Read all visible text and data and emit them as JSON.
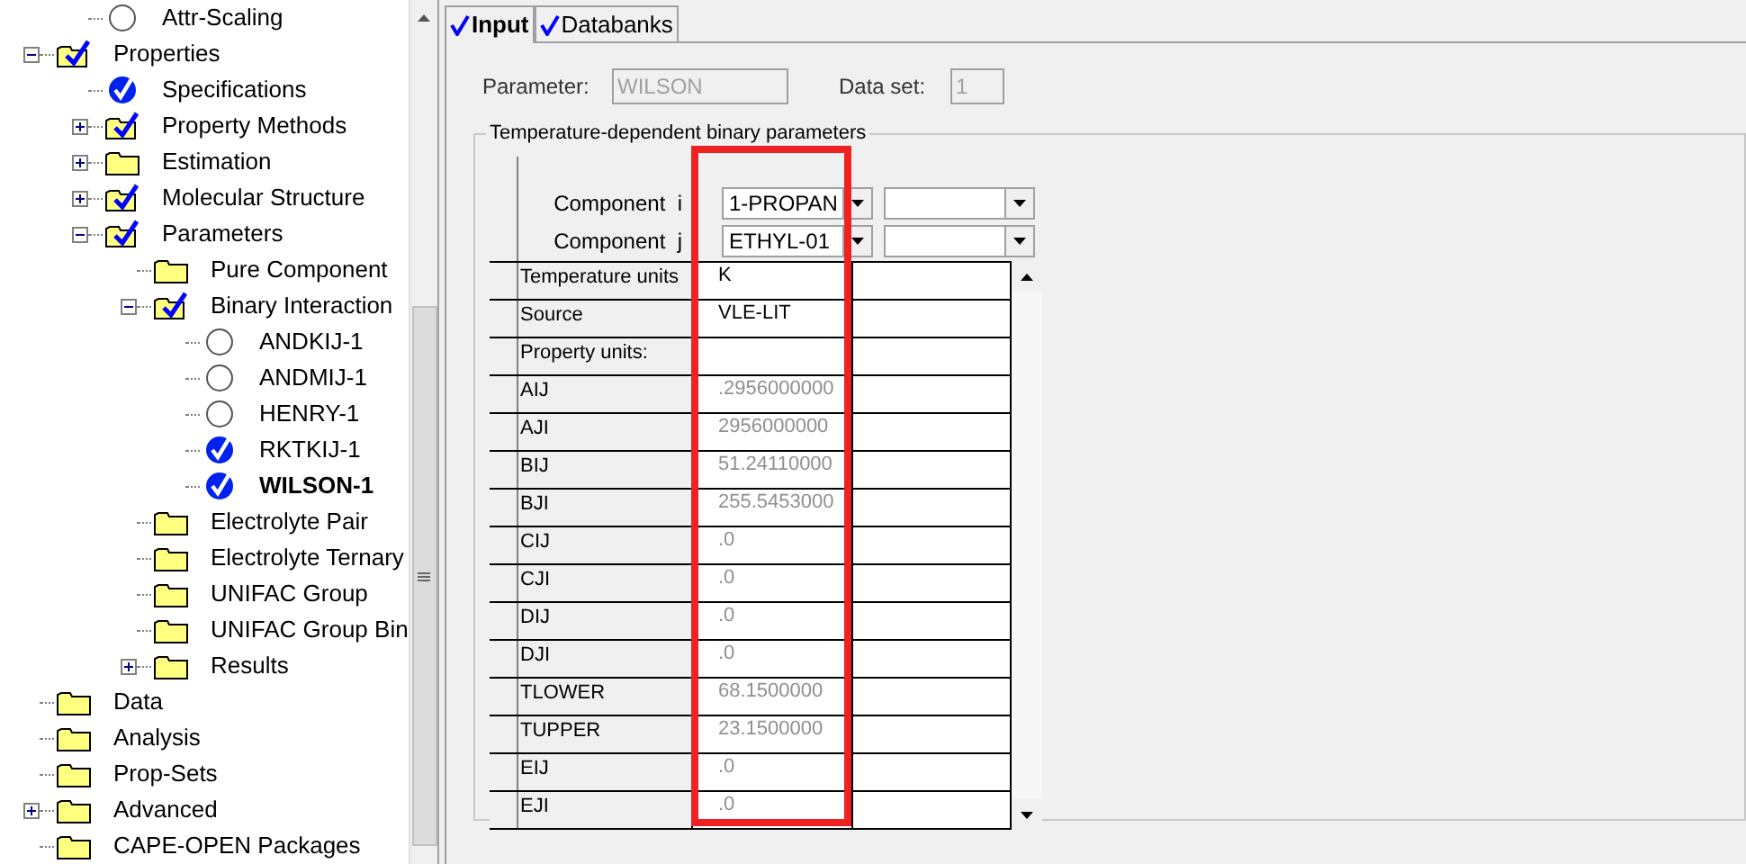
{
  "tree_top_children": [
    {
      "label": "Attr-Scaling",
      "kind": "circle",
      "selected": false
    }
  ],
  "tree": [
    {
      "label": "Properties",
      "kind": "checked-folder",
      "expanded": true,
      "selected": false,
      "children": [
        {
          "label": "Specifications",
          "kind": "check-circle",
          "selected": false
        },
        {
          "label": "Property Methods",
          "kind": "checked-folder",
          "expanded": false,
          "selected": false
        },
        {
          "label": "Estimation",
          "kind": "folder",
          "expanded": false,
          "selected": false
        },
        {
          "label": "Molecular Structure",
          "kind": "checked-folder",
          "expanded": false,
          "selected": false
        },
        {
          "label": "Parameters",
          "kind": "checked-folder",
          "expanded": true,
          "selected": false,
          "children": [
            {
              "label": "Pure Component",
              "kind": "folder",
              "selected": false
            },
            {
              "label": "Binary Interaction",
              "kind": "checked-folder",
              "expanded": true,
              "selected": false,
              "children": [
                {
                  "label": "ANDKIJ-1",
                  "kind": "circle",
                  "selected": false
                },
                {
                  "label": "ANDMIJ-1",
                  "kind": "circle",
                  "selected": false
                },
                {
                  "label": "HENRY-1",
                  "kind": "circle",
                  "selected": false
                },
                {
                  "label": "RKTKIJ-1",
                  "kind": "check-circle",
                  "selected": false
                },
                {
                  "label": "WILSON-1",
                  "kind": "check-circle",
                  "selected": true
                }
              ]
            },
            {
              "label": "Electrolyte Pair",
              "kind": "folder",
              "selected": false
            },
            {
              "label": "Electrolyte Ternary",
              "kind": "folder",
              "selected": false
            },
            {
              "label": "UNIFAC Group",
              "kind": "folder",
              "selected": false
            },
            {
              "label": "UNIFAC Group Bin",
              "kind": "folder",
              "selected": false
            },
            {
              "label": "Results",
              "kind": "folder",
              "expanded": false,
              "selected": false
            }
          ]
        }
      ]
    },
    {
      "label": "Data",
      "kind": "folder",
      "selected": false
    },
    {
      "label": "Analysis",
      "kind": "folder",
      "selected": false
    },
    {
      "label": "Prop-Sets",
      "kind": "folder",
      "selected": false
    },
    {
      "label": "Advanced",
      "kind": "folder",
      "expanded": false,
      "selected": false
    },
    {
      "label": "CAPE-OPEN Packages",
      "kind": "folder",
      "selected": false
    }
  ],
  "tabs": [
    {
      "label": "Input",
      "checked": true,
      "selected": true
    },
    {
      "label": "Databanks",
      "checked": true,
      "selected": false
    }
  ],
  "parameter": {
    "label": "Parameter:",
    "value": "WILSON",
    "disabled": true
  },
  "data_set": {
    "label": "Data set:",
    "value": "1",
    "disabled": true
  },
  "group_title": "Temperature-dependent binary parameters",
  "components": [
    {
      "label": "Component  i",
      "value": "1-PROPAN"
    },
    {
      "label": "Component  j",
      "value": "ETHYL-01"
    }
  ],
  "rows": [
    {
      "label": "Temperature units",
      "value": "K",
      "kind": "setting"
    },
    {
      "label": "Source",
      "value": "VLE-LIT",
      "kind": "setting"
    },
    {
      "label": "Property units:",
      "kind": "setting"
    },
    {
      "label": "AIJ",
      "value": ".2956000000",
      "kind": "parameter"
    },
    {
      "label": "AJI",
      "value": "2956000000",
      "kind": "parameter"
    },
    {
      "label": "BIJ",
      "value": "51.24110000",
      "kind": "parameter"
    },
    {
      "label": "BJI",
      "value": "255.5453000",
      "kind": "parameter"
    },
    {
      "label": "CIJ",
      "value": ".0",
      "kind": "parameter"
    },
    {
      "label": "CJI",
      "value": ".0",
      "kind": "parameter"
    },
    {
      "label": "DIJ",
      "value": ".0",
      "kind": "parameter"
    },
    {
      "label": "DJI",
      "value": ".0",
      "kind": "parameter"
    },
    {
      "label": "TLOWER",
      "value": "68.1500000",
      "kind": "parameter"
    },
    {
      "label": "TUPPER",
      "value": "23.1500000",
      "kind": "parameter"
    },
    {
      "label": "EIJ",
      "value": ".0",
      "kind": "parameter"
    },
    {
      "label": "EJI",
      "value": ".0",
      "kind": "parameter"
    }
  ]
}
